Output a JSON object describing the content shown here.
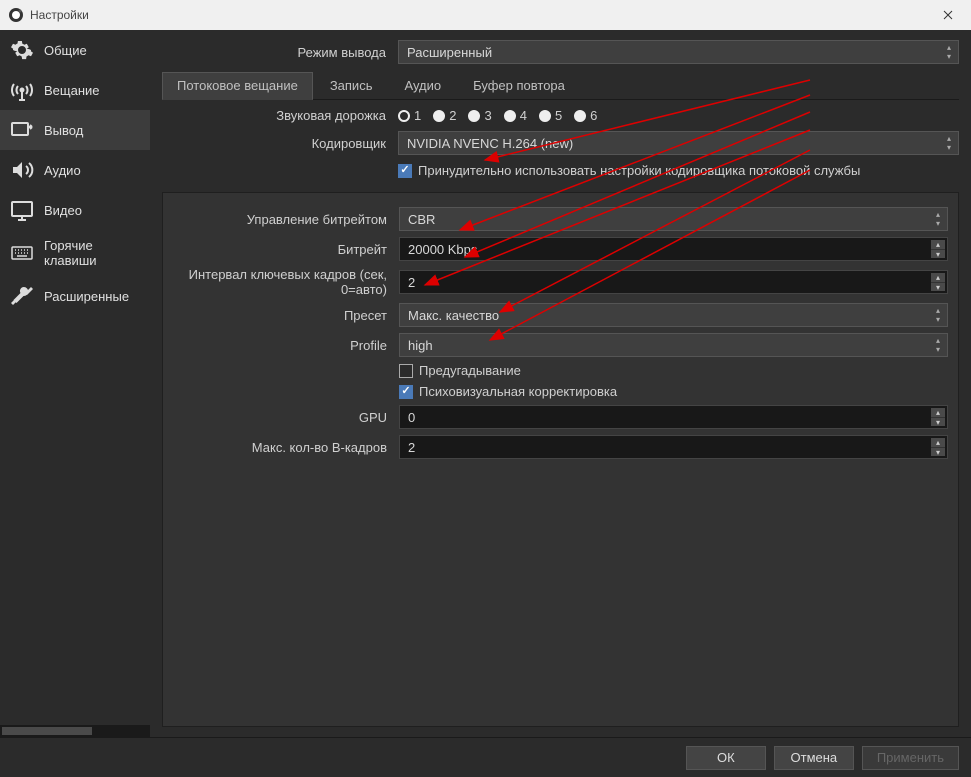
{
  "window": {
    "title": "Настройки"
  },
  "sidebar": {
    "items": [
      {
        "label": "Общие"
      },
      {
        "label": "Вещание"
      },
      {
        "label": "Вывод"
      },
      {
        "label": "Аудио"
      },
      {
        "label": "Видео"
      },
      {
        "label": "Горячие клавиши"
      },
      {
        "label": "Расширенные"
      }
    ]
  },
  "output_mode": {
    "label": "Режим вывода",
    "value": "Расширенный"
  },
  "tabs": [
    {
      "label": "Потоковое вещание"
    },
    {
      "label": "Запись"
    },
    {
      "label": "Аудио"
    },
    {
      "label": "Буфер повтора"
    }
  ],
  "audio_track": {
    "label": "Звуковая дорожка",
    "options": [
      "1",
      "2",
      "3",
      "4",
      "5",
      "6"
    ],
    "selected": "1"
  },
  "encoder": {
    "label": "Кодировщик",
    "value": "NVIDIA NVENC H.264 (new)"
  },
  "enforce": {
    "label": "Принудительно использовать настройки кодировщика потоковой службы",
    "checked": true
  },
  "settings": {
    "rate_control": {
      "label": "Управление битрейтом",
      "value": "CBR"
    },
    "bitrate": {
      "label": "Битрейт",
      "value": "20000 Kbps"
    },
    "keyframe": {
      "label": "Интервал ключевых кадров (сек, 0=авто)",
      "value": "2"
    },
    "preset": {
      "label": "Пресет",
      "value": "Макс. качество"
    },
    "profile": {
      "label": "Profile",
      "value": "high"
    },
    "lookahead": {
      "label": "Предугадывание",
      "checked": false
    },
    "psycho": {
      "label": "Психовизуальная корректировка",
      "checked": true
    },
    "gpu": {
      "label": "GPU",
      "value": "0"
    },
    "bframes": {
      "label": "Макс. кол-во B-кадров",
      "value": "2"
    }
  },
  "footer": {
    "ok": "ОК",
    "cancel": "Отмена",
    "apply": "Применить"
  }
}
